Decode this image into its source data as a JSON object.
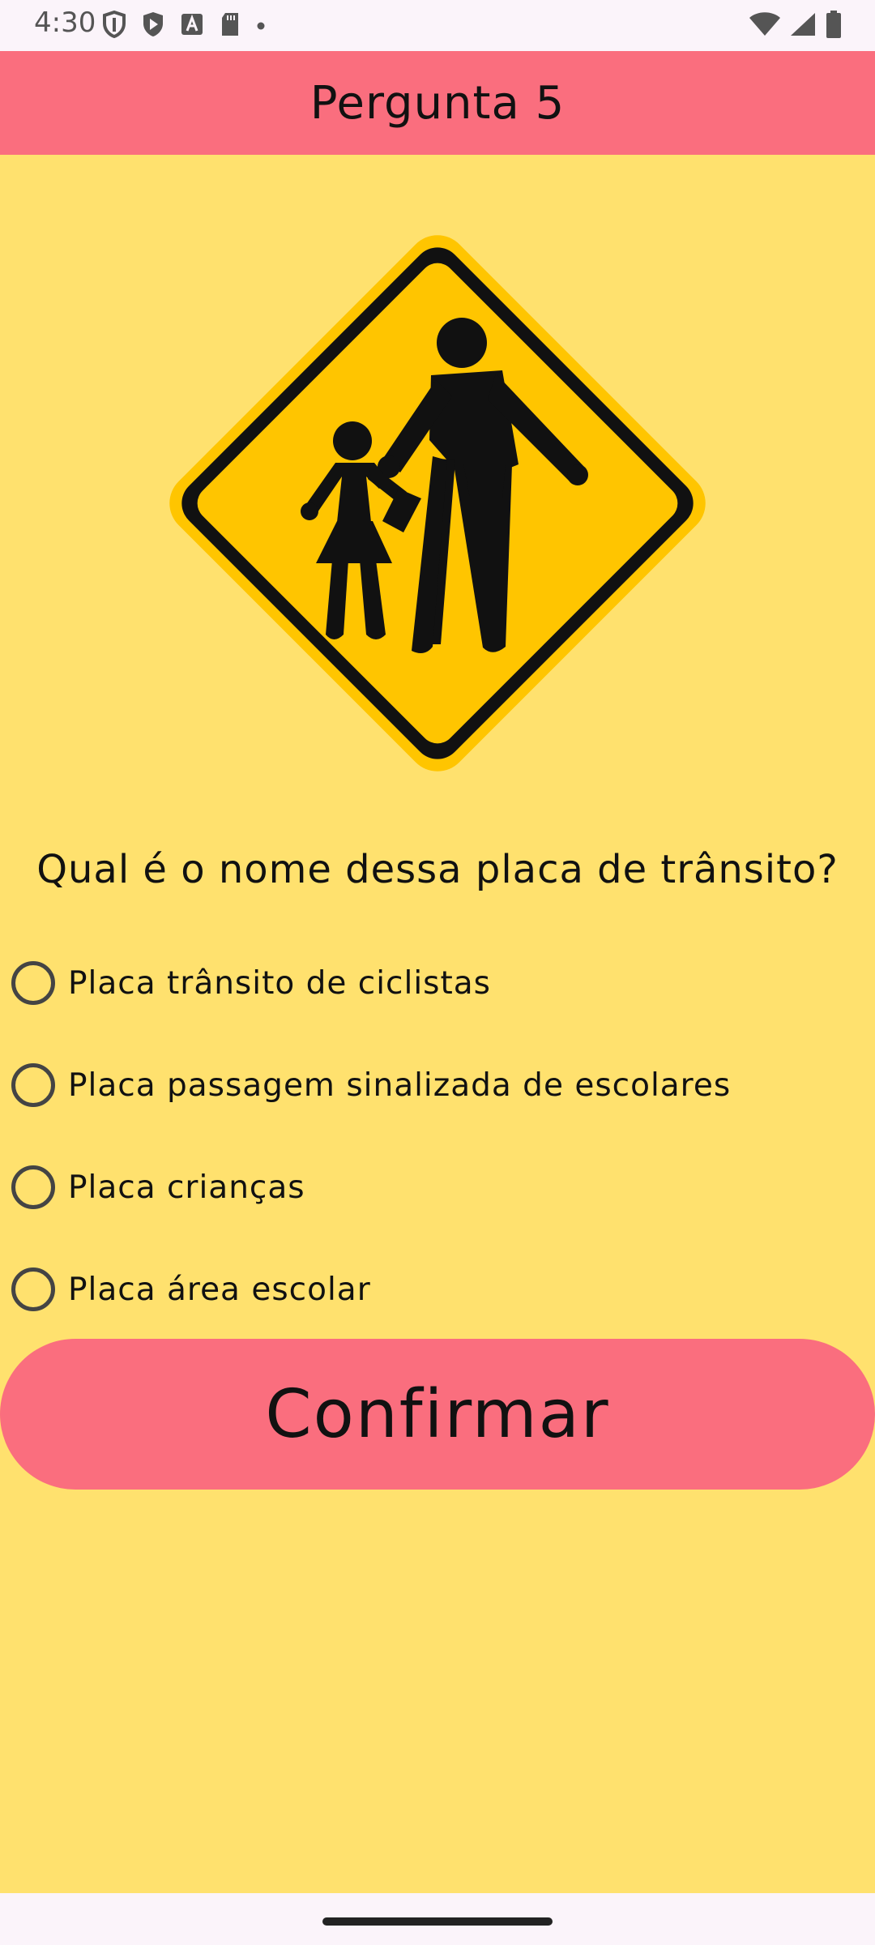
{
  "status_bar": {
    "time": "4:30",
    "left_icons": [
      "shield-icon",
      "play-protect-icon",
      "font-a-icon",
      "sd-card-icon",
      "dot-icon"
    ],
    "right_icons": [
      "wifi-icon",
      "cellular-signal-icon",
      "battery-icon"
    ]
  },
  "app_bar": {
    "title": "Pergunta 5",
    "color": "#FA6E7E"
  },
  "sign": {
    "icon": "children-crossing-sign",
    "colors": {
      "fill": "#FFC500",
      "border": "#111111"
    }
  },
  "question": {
    "text": "Qual é o nome dessa placa de trânsito?"
  },
  "options": [
    {
      "label": "Placa trânsito de ciclistas",
      "selected": false
    },
    {
      "label": "Placa passagem sinalizada de escolares",
      "selected": false
    },
    {
      "label": "Placa crianças",
      "selected": false
    },
    {
      "label": "Placa área escolar",
      "selected": false
    }
  ],
  "confirm_button": {
    "label": "Confirmar"
  },
  "theme": {
    "background": "#FFE16E",
    "accent": "#FA6E7E"
  }
}
